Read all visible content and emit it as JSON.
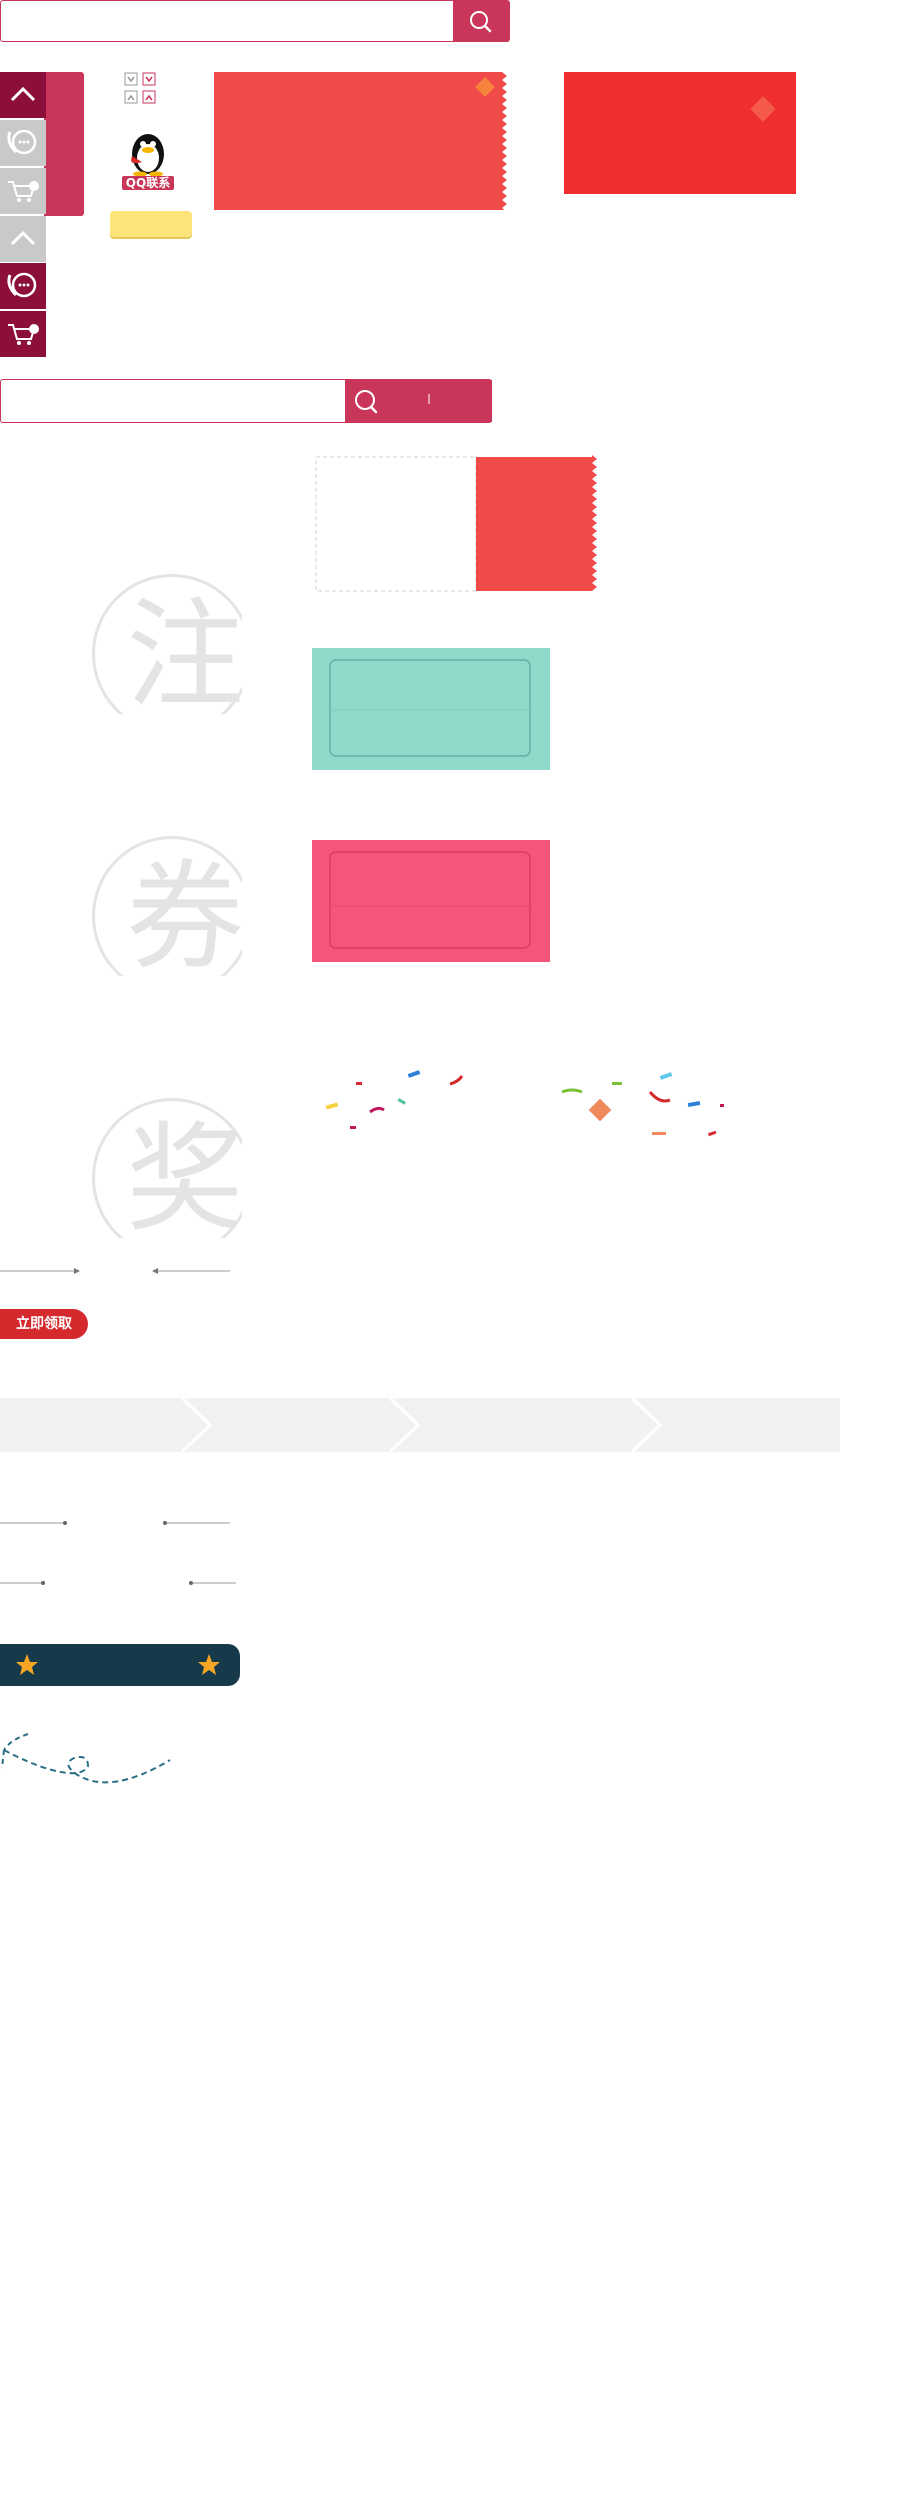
{
  "search_top": {
    "value": "",
    "button_icon": "search-icon",
    "accent": "#c9365a"
  },
  "sidebar_tools": {
    "dark": [
      "chevron-up-icon",
      "phone-chat-icon",
      "cart-icon"
    ],
    "light": [
      "chevron-up-icon",
      "phone-chat-icon",
      "cart-icon"
    ],
    "dark_color": "#8b0f3a",
    "light_color": "#c9c9c9"
  },
  "qq_widget": {
    "label": "QQ联系",
    "icon": "qq-penguin-icon"
  },
  "arrow_toggles": [
    "chevron-down-icon",
    "chevron-up-icon"
  ],
  "search_bottom": {
    "value": "",
    "button_icon": "search-icon"
  },
  "watermarks": [
    "注",
    "券",
    "奖"
  ],
  "coupon_colors": {
    "red": "#f04a4a",
    "teal": "#8fd9cb",
    "pink": "#f5557a",
    "bright_red": "#ef2f2f"
  },
  "cta": {
    "claim_label": "立即领取",
    "color": "#d42a2e"
  },
  "steps_bar": {
    "color": "#f2f2f2",
    "count": 4
  },
  "banner": {
    "color": "#173a4a",
    "icons": [
      "star-icon",
      "star-icon"
    ]
  },
  "decor": {
    "confetti": "confetti-icon",
    "dashed_path": "dashed-path-icon"
  }
}
